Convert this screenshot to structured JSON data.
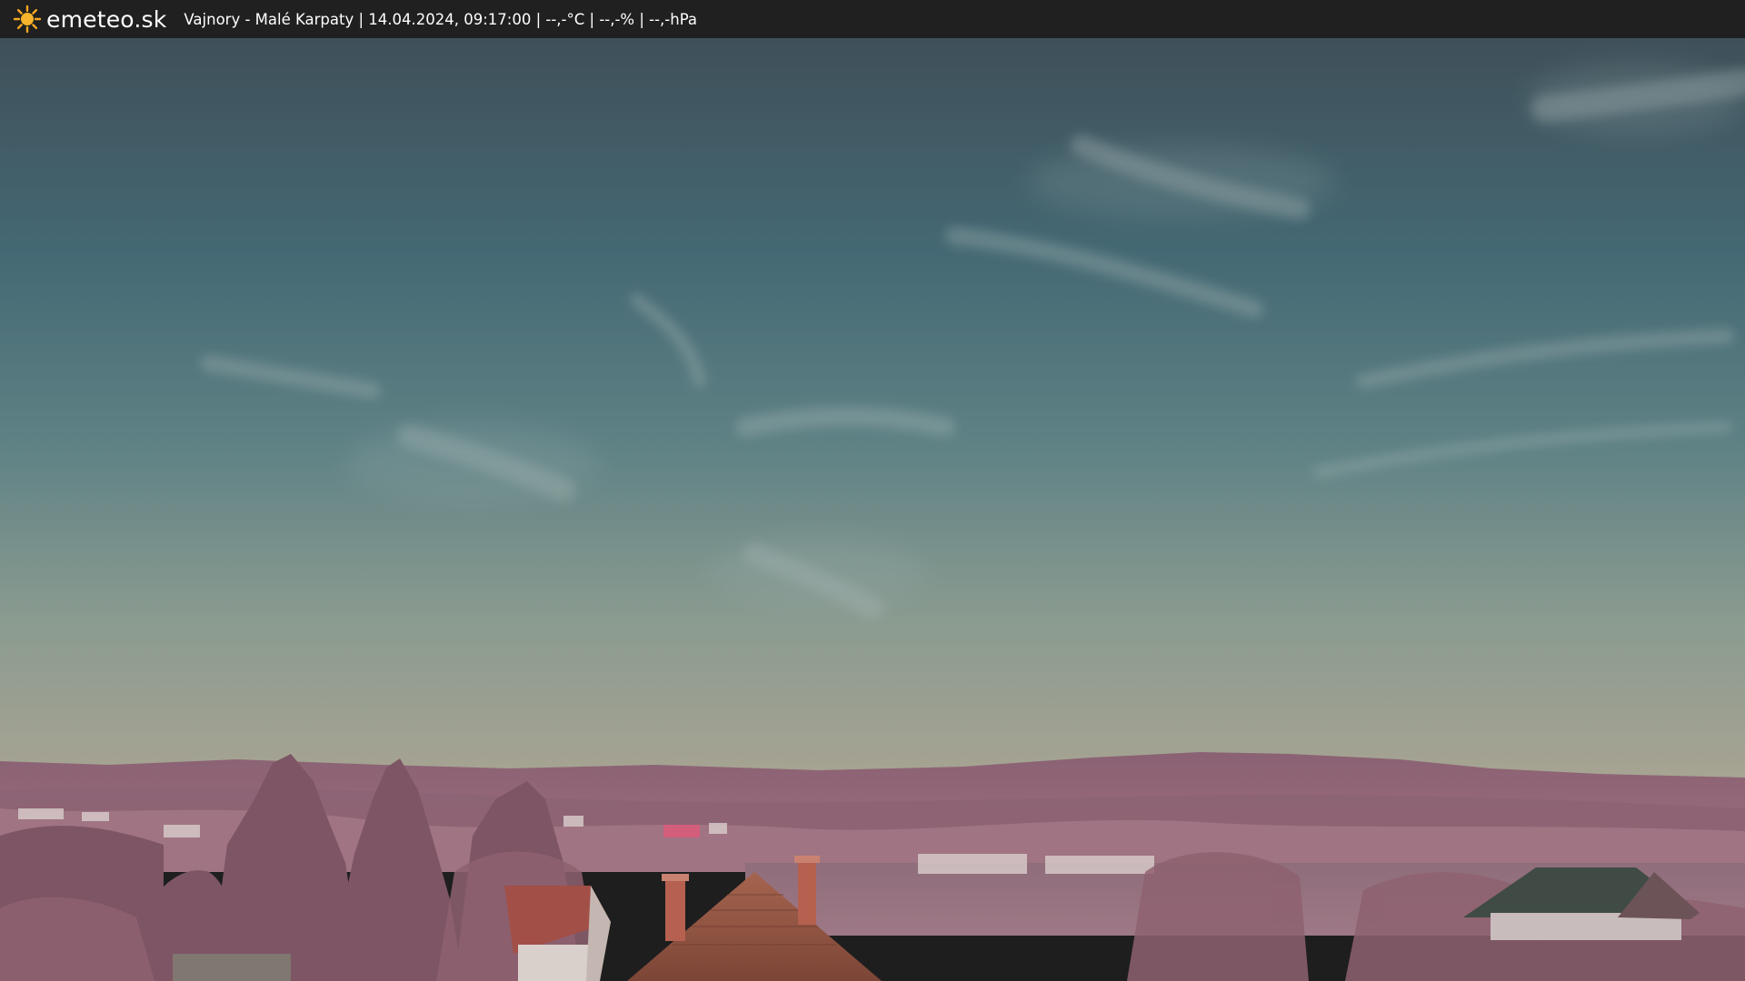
{
  "header": {
    "logo_text": "emeteo.sk",
    "caption": "Vajnory - Malé Karpaty | 14.04.2024, 09:17:00 | --,-°C | --,-% | --,-hPa",
    "logo_icon": "sun-icon"
  },
  "colors": {
    "header_background": "#202020",
    "header_text": "#ffffff",
    "sun": "#f5a623"
  }
}
